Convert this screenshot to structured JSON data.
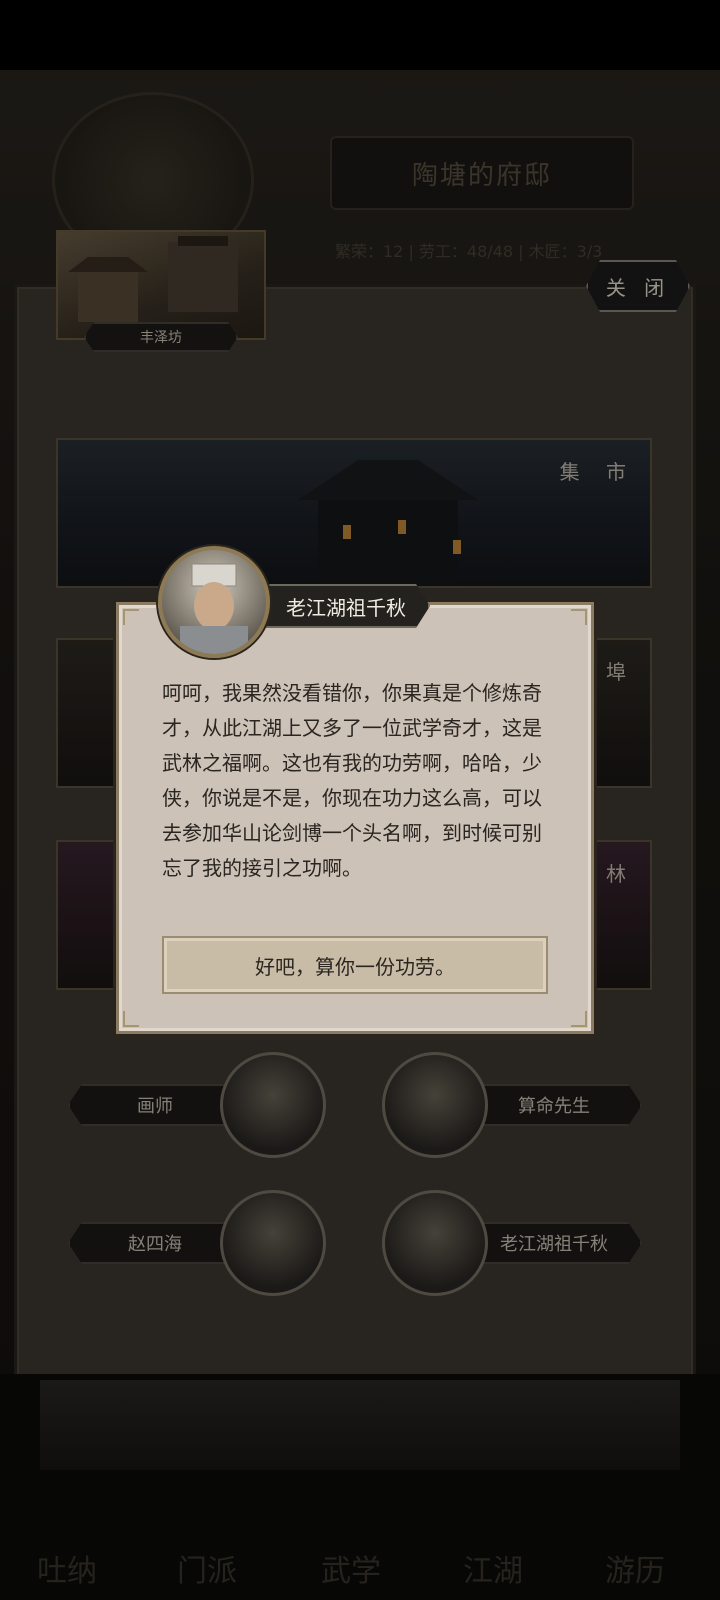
{
  "background": {
    "residence_title": "陶塘的府邸",
    "stats_text": "繁荣：12 | 劳工：48/48 | 木匠：3/3",
    "thumbnail_label": "丰泽坊",
    "close_label": "关 闭",
    "banners": [
      {
        "label": "集 市"
      },
      {
        "label": "江 埠"
      },
      {
        "label": "园 林"
      }
    ],
    "npcs": [
      {
        "name": "画师",
        "icon": "painter-portrait-icon"
      },
      {
        "name": "算命先生",
        "icon": "fortune-teller-portrait-icon"
      },
      {
        "name": "赵四海",
        "icon": "zhao-sihai-portrait-icon"
      },
      {
        "name": "老江湖祖千秋",
        "icon": "zu-qianqiu-portrait-icon"
      }
    ],
    "bottom_nav": [
      {
        "label": "吐纳"
      },
      {
        "label": "门派"
      },
      {
        "label": "武学"
      },
      {
        "label": "江湖"
      },
      {
        "label": "游历"
      }
    ]
  },
  "dialog": {
    "speaker_name": "老江湖祖千秋",
    "speaker_icon": "zu-qianqiu-portrait-icon",
    "message": "呵呵，我果然没看错你，你果真是个修炼奇才，从此江湖上又多了一位武学奇才，这是武林之福啊。这也有我的功劳啊，哈哈，少侠，你说是不是，你现在功力这么高，可以去参加华山论剑博一个头名啊，到时候可别忘了我的接引之功啊。",
    "reply_label": "好吧，算你一份功劳。"
  },
  "colors": {
    "dialog_bg": "#cdc2b8",
    "dialog_border": "#8a7c62",
    "dark_ui": "#1c1b1a",
    "gold_accent": "#a69670"
  }
}
